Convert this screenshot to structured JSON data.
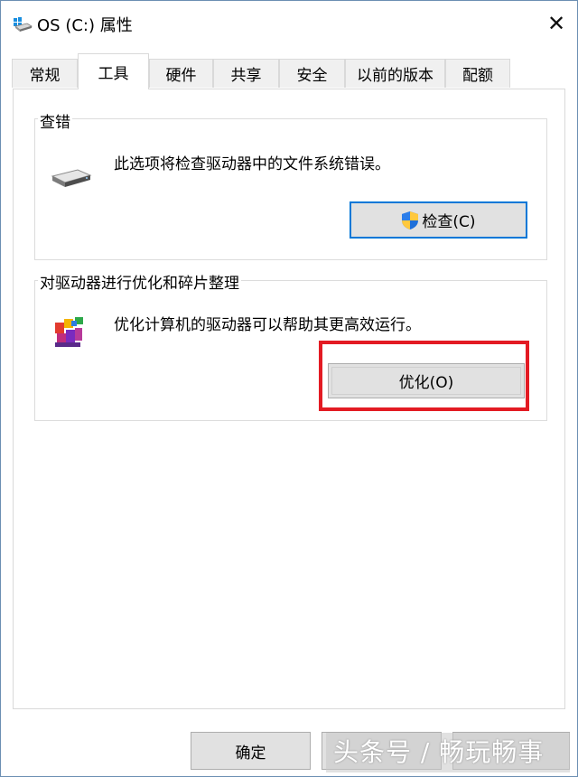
{
  "window": {
    "title": "OS (C:) 属性",
    "close_glyph": "✕"
  },
  "tabs": [
    {
      "label": "常规",
      "active": false
    },
    {
      "label": "工具",
      "active": true
    },
    {
      "label": "硬件",
      "active": false
    },
    {
      "label": "共享",
      "active": false
    },
    {
      "label": "安全",
      "active": false
    },
    {
      "label": "以前的版本",
      "active": false
    },
    {
      "label": "配额",
      "active": false
    }
  ],
  "error_check": {
    "group_title": "查错",
    "description": "此选项将检查驱动器中的文件系统错误。",
    "button_label": "检查(C)",
    "icon": "drive-icon",
    "button_icon": "uac-shield-icon"
  },
  "optimize": {
    "group_title": "对驱动器进行优化和碎片整理",
    "description": "优化计算机的驱动器可以帮助其更高效运行。",
    "button_label": "优化(O)",
    "icon": "defrag-icon"
  },
  "footer": {
    "ok_label": "确定",
    "watermark": "头条号 / 畅玩畅事"
  },
  "colors": {
    "highlight": "#e31b23",
    "focus": "#0078d7",
    "button_face": "#e1e1e1"
  }
}
